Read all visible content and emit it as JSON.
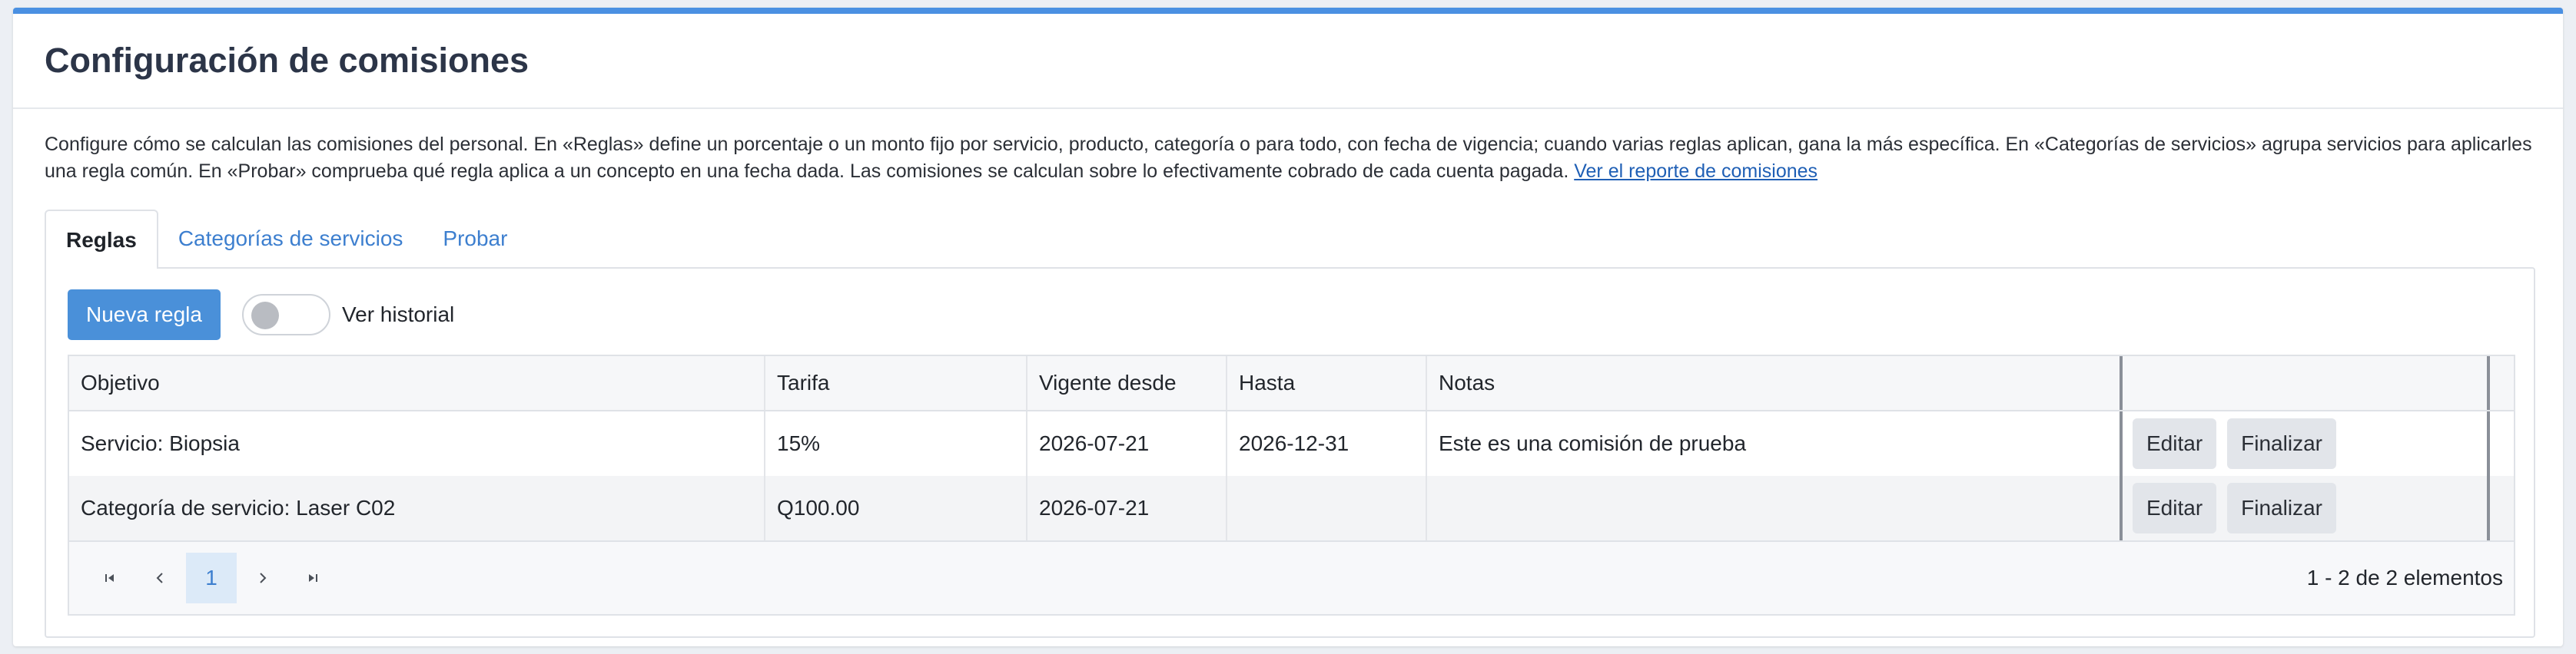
{
  "page": {
    "title": "Configuración de comisiones",
    "accent_color": "#4a90e2"
  },
  "description": {
    "text": "Configure cómo se calculan las comisiones del personal. En «Reglas» define un porcentaje o un monto fijo por servicio, producto, categoría o para todo, con fecha de vigencia; cuando varias reglas aplican, gana la más específica. En «Categorías de servicios» agrupa servicios para aplicarles una regla común. En «Probar» comprueba qué regla aplica a un concepto en una fecha dada. Las comisiones se calculan sobre lo efectivamente cobrado de cada cuenta pagada.",
    "link": "Ver el reporte de comisiones"
  },
  "tabs": [
    {
      "label": "Reglas",
      "active": true
    },
    {
      "label": "Categorías de servicios",
      "active": false
    },
    {
      "label": "Probar",
      "active": false
    }
  ],
  "toolbar": {
    "new_rule_label": "Nueva regla",
    "history_toggle_label": "Ver historial",
    "history_toggle_on": false
  },
  "table": {
    "columns": [
      "Objetivo",
      "Tarifa",
      "Vigente desde",
      "Hasta",
      "Notas",
      "",
      ""
    ],
    "rows": [
      {
        "objetivo": "Servicio: Biopsia",
        "tarifa": "15%",
        "desde": "2026-07-21",
        "hasta": "2026-12-31",
        "notas": "Este es una comisión de prueba",
        "edit_label": "Editar",
        "finish_label": "Finalizar"
      },
      {
        "objetivo": "Categoría de servicio: Laser C02",
        "tarifa": "Q100.00",
        "desde": "2026-07-21",
        "hasta": "",
        "notas": "",
        "edit_label": "Editar",
        "finish_label": "Finalizar"
      }
    ]
  },
  "pager": {
    "first_icon": "first-page-icon",
    "prev_icon": "chevron-left-icon",
    "current_page": "1",
    "next_icon": "chevron-right-icon",
    "last_icon": "last-page-icon",
    "info": "1 - 2 de 2 elementos"
  }
}
